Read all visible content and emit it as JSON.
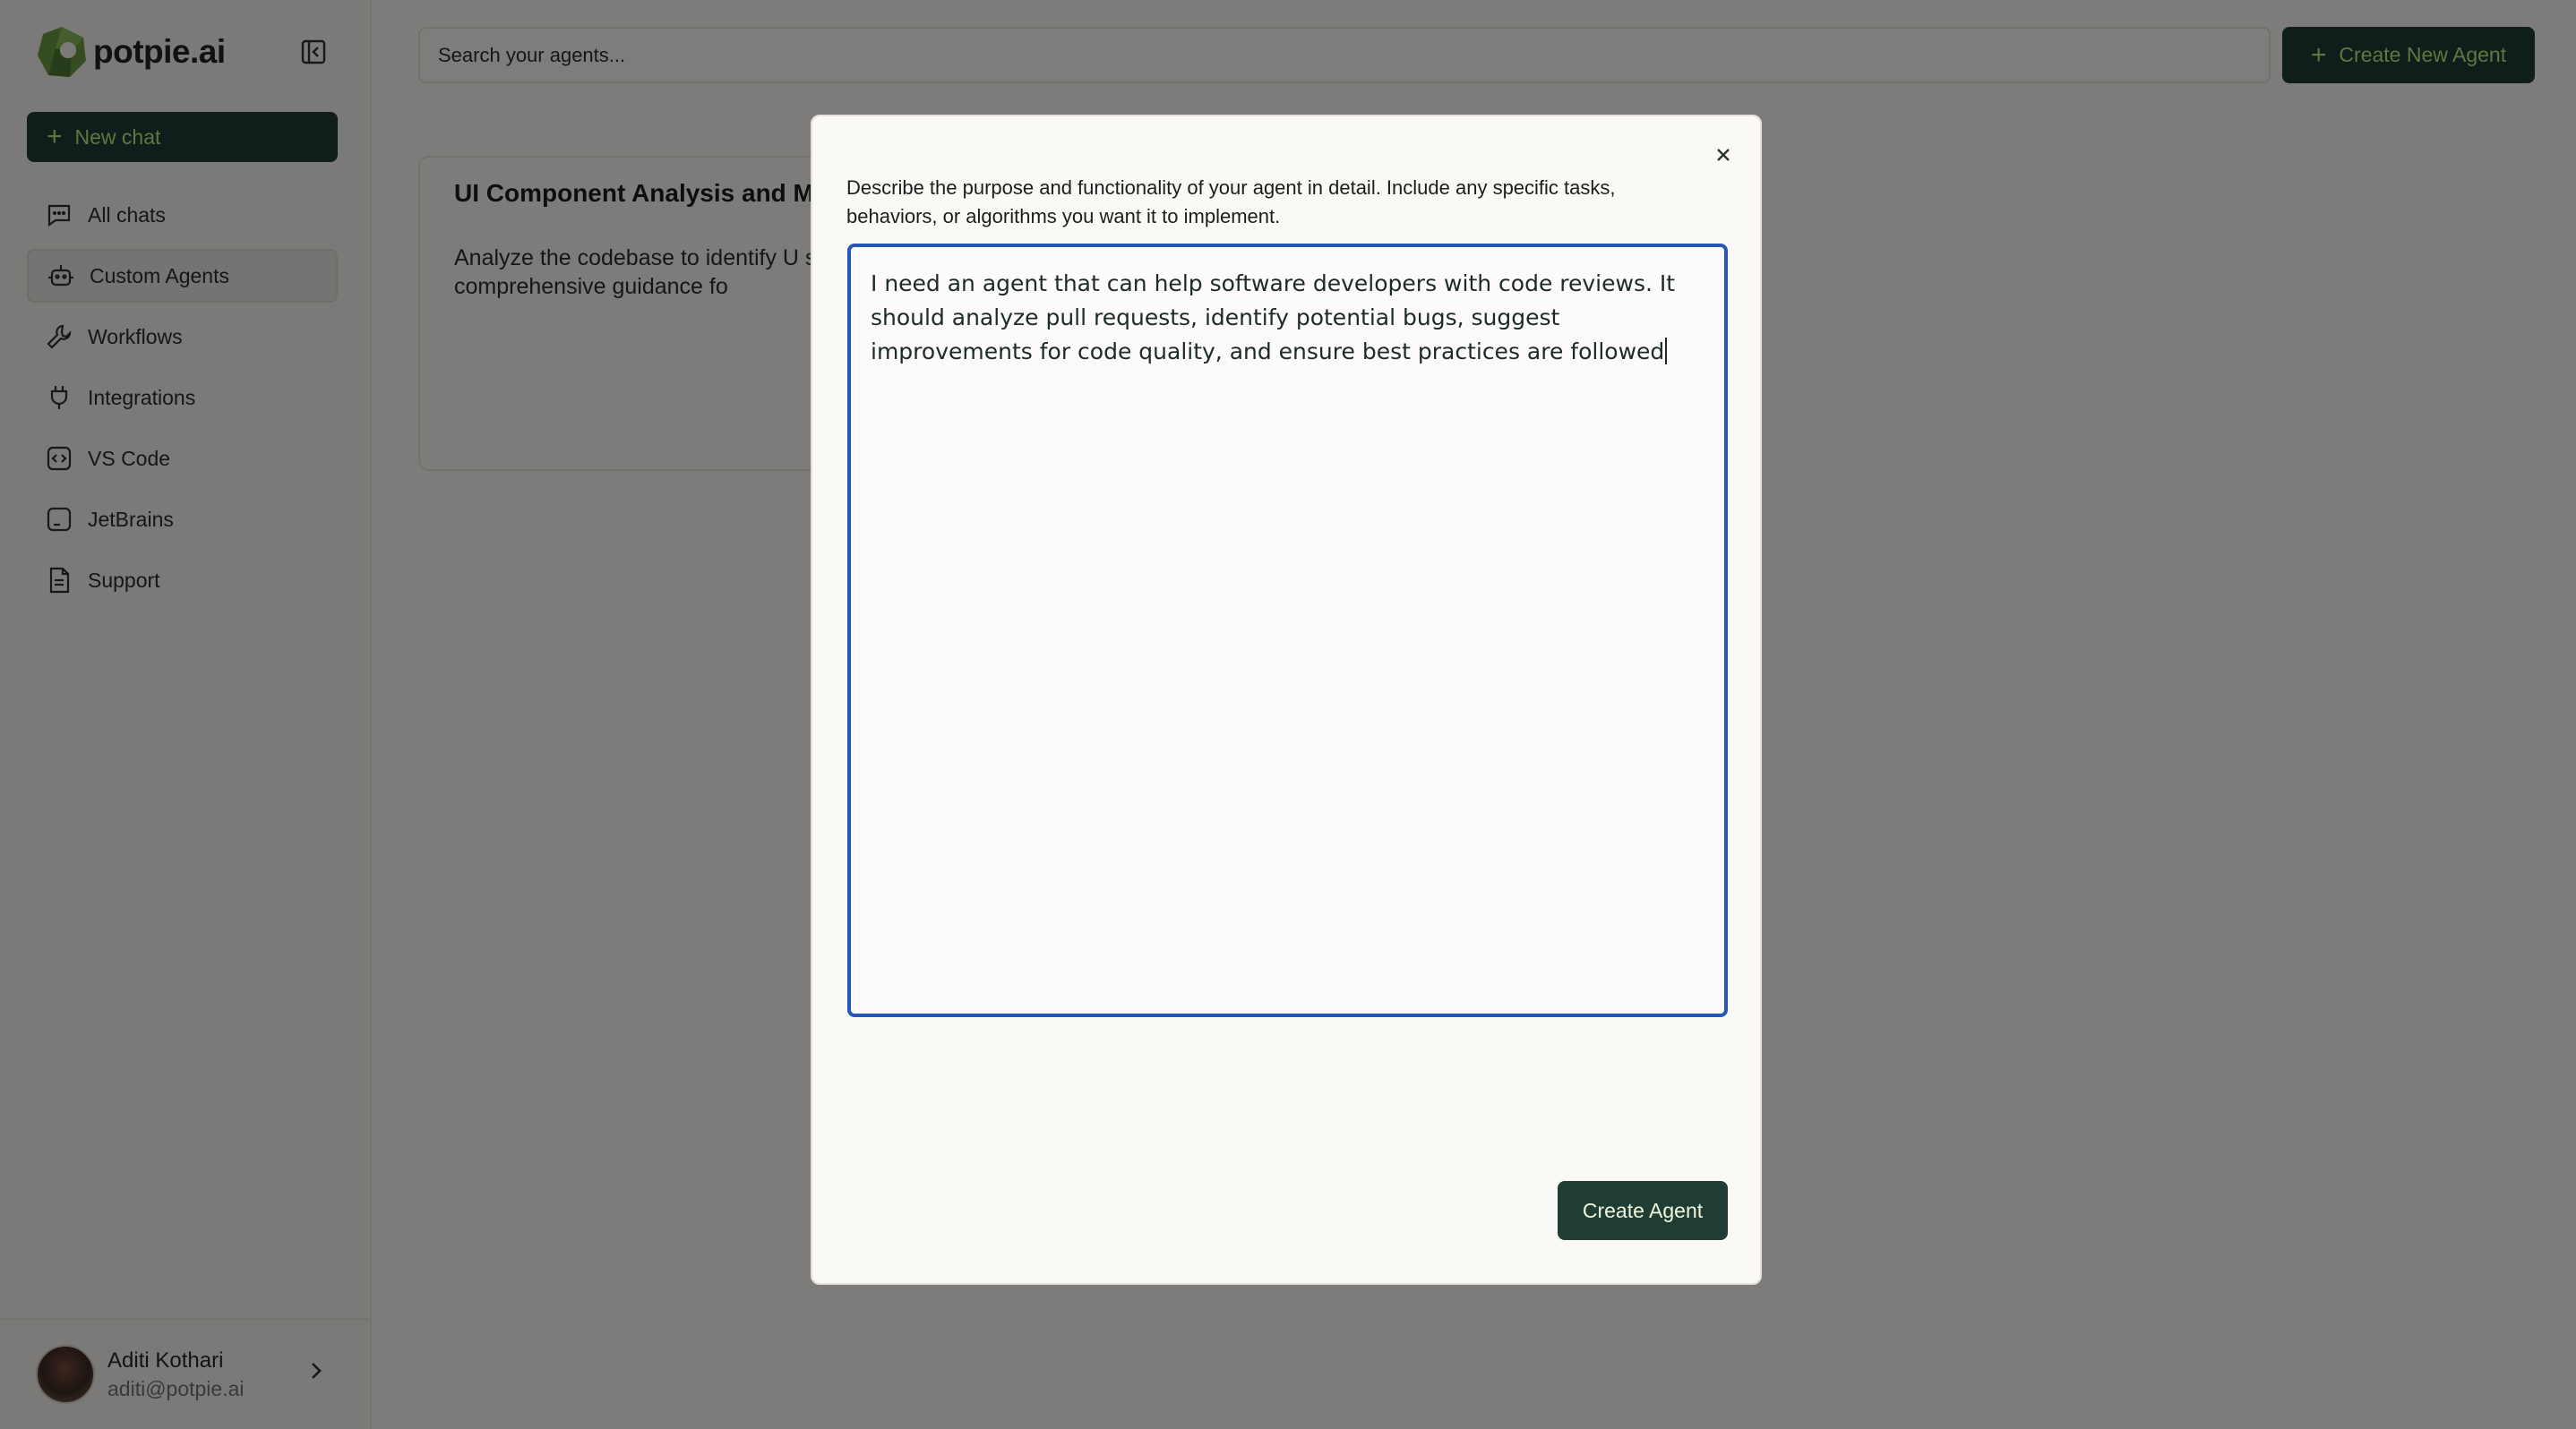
{
  "app": {
    "name": "potpie.ai",
    "brand_color": "#1f3d34",
    "accent_color": "#c5e87e"
  },
  "sidebar": {
    "new_chat_label": "New chat",
    "items": [
      {
        "label": "All chats",
        "icon": "chat-icon",
        "active": false
      },
      {
        "label": "Custom Agents",
        "icon": "bot-icon",
        "active": true
      },
      {
        "label": "Workflows",
        "icon": "wrench-icon",
        "active": false
      },
      {
        "label": "Integrations",
        "icon": "plug-icon",
        "active": false
      },
      {
        "label": "VS Code",
        "icon": "code-icon",
        "active": false
      },
      {
        "label": "JetBrains",
        "icon": "jetbrains-icon",
        "active": false
      },
      {
        "label": "Support",
        "icon": "document-icon",
        "active": false
      }
    ],
    "user": {
      "name": "Aditi Kothari",
      "email": "aditi@potpie.ai"
    }
  },
  "header": {
    "search_placeholder": "Search your agents...",
    "create_button_label": "Create New Agent"
  },
  "agents": [
    {
      "title": "UI Component Analysis and Mo",
      "description": "Analyze the codebase to identify U structures, understand their relatio provide comprehensive guidance fo"
    }
  ],
  "modal": {
    "description": "Describe the purpose and functionality of your agent in detail. Include any specific tasks, behaviors, or algorithms you want it to implement.",
    "textarea_value": "I need an agent that can help software developers with code reviews. It should analyze pull requests, identify potential bugs, suggest improvements for code quality, and ensure best practices are followed",
    "submit_label": "Create Agent"
  }
}
